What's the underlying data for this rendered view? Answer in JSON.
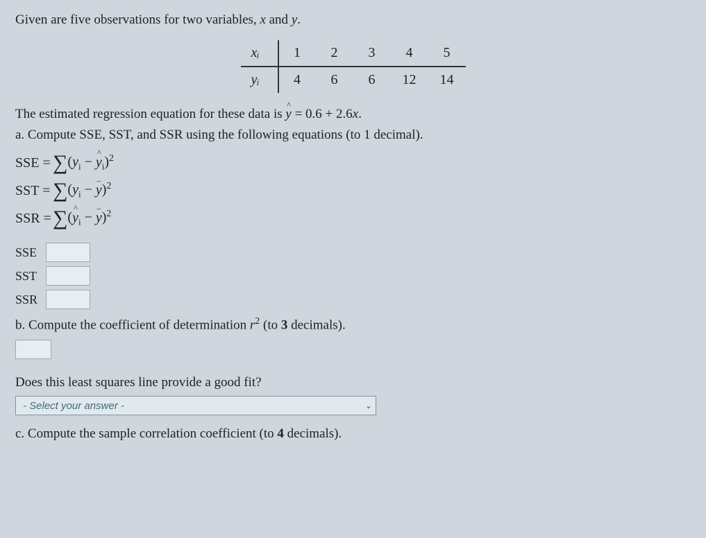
{
  "intro": "Given are five observations for two variables, x and y.",
  "data_table": {
    "x_label": "xᵢ",
    "y_label": "yᵢ",
    "x": [
      1,
      2,
      3,
      4,
      5
    ],
    "y": [
      4,
      6,
      6,
      12,
      14
    ]
  },
  "regression_text_prefix": "The estimated regression equation for these data is ",
  "regression_eq": "ŷ = 0.6 + 2.6x.",
  "part_a": {
    "label": "a. Compute SSE, SST, and SSR using the following equations (to 1 decimal).",
    "formulas": {
      "sse": "SSE = Σ (yᵢ − ŷᵢ)²",
      "sst": "SST = Σ (yᵢ − ȳ)²",
      "ssr": "SSR = Σ (ŷᵢ − ȳ)²"
    },
    "inputs": [
      "SSE",
      "SST",
      "SSR"
    ]
  },
  "part_b": {
    "label": "b. Compute the coefficient of determination r² (to 3 decimals).",
    "fit_question": "Does this least squares line provide a good fit?",
    "select_placeholder": "- Select your answer -"
  },
  "part_c": {
    "label": "c. Compute the sample correlation coefficient (to 4 decimals)."
  },
  "chart_data": {
    "type": "table",
    "title": "Observations for x and y",
    "categories": [
      1,
      2,
      3,
      4,
      5
    ],
    "series": [
      {
        "name": "x_i",
        "values": [
          1,
          2,
          3,
          4,
          5
        ]
      },
      {
        "name": "y_i",
        "values": [
          4,
          6,
          6,
          12,
          14
        ]
      }
    ],
    "regression": {
      "intercept": 0.6,
      "slope": 2.6
    }
  }
}
